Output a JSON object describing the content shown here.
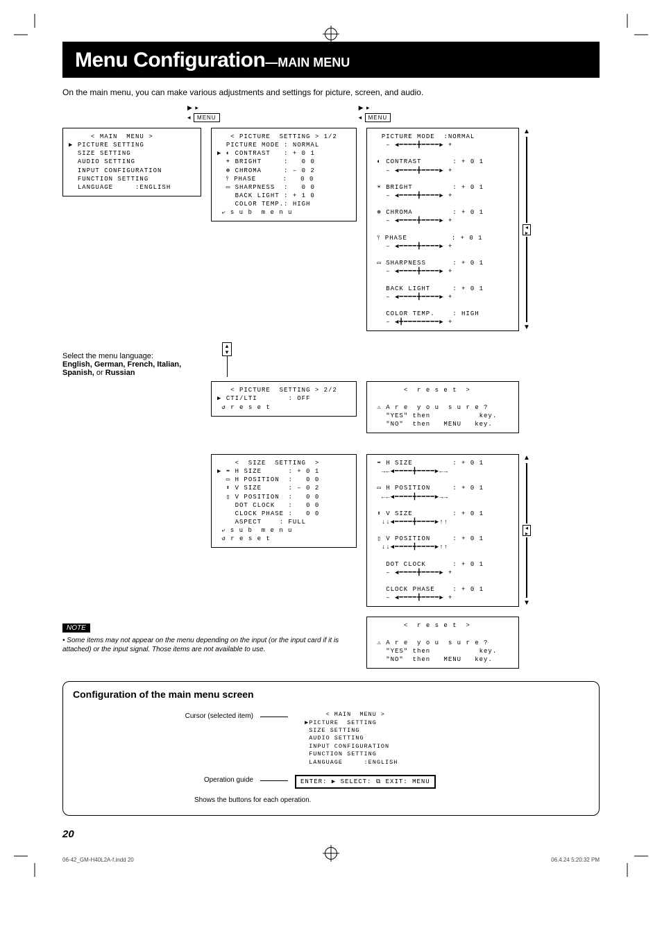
{
  "title": {
    "main": "Menu Configuration",
    "sub": "—MAIN MENU"
  },
  "intro": "On the main menu, you can make various adjustments and settings for picture, screen, and audio.",
  "menu_label": "MENU",
  "main_menu": {
    "heading": "< MAIN  MENU >",
    "items": [
      "PICTURE SETTING",
      "SIZE SETTING",
      "AUDIO SETTING",
      "INPUT CONFIGURATION",
      "FUNCTION SETTING",
      "LANGUAGE     :ENGLISH"
    ],
    "cursor_on": "PICTURE SETTING"
  },
  "lang_note": {
    "lead": "Select the menu language:",
    "langs": "English, German, French, Italian, Spanish,",
    "or": " or ",
    "last": "Russian"
  },
  "picture_p1": {
    "heading": "< PICTURE  SETTING > 1/2",
    "rows": [
      [
        "PICTURE MODE",
        ": NORMAL"
      ],
      [
        "CONTRAST",
        ": + 0 1"
      ],
      [
        "BRIGHT",
        ":   0 0"
      ],
      [
        "CHROMA",
        ": – 0 2"
      ],
      [
        "PHASE",
        ":   0 0"
      ],
      [
        "SHARPNESS",
        ":   0 0"
      ],
      [
        "BACK LIGHT",
        ": + 1 0"
      ],
      [
        "COLOR TEMP.",
        ": HIGH"
      ]
    ],
    "sub": "s u b  m e n u"
  },
  "picture_p2": {
    "heading": "< PICTURE  SETTING > 2/2",
    "rows": [
      [
        "CTI/LTI",
        ": OFF"
      ]
    ],
    "reset": "r e s e t"
  },
  "picture_sliders": {
    "mode_row": [
      "PICTURE MODE",
      ":NORMAL"
    ],
    "rows": [
      [
        "CONTRAST",
        ": + 0 1"
      ],
      [
        "BRIGHT",
        ": + 0 1"
      ],
      [
        "CHROMA",
        ": + 0 1"
      ],
      [
        "PHASE",
        ": + 0 1"
      ],
      [
        "SHARPNESS",
        ": + 0 1"
      ],
      [
        "BACK LIGHT",
        ": + 0 1"
      ],
      [
        "COLOR TEMP.",
        ": HIGH"
      ]
    ]
  },
  "reset_box": {
    "heading": "<  r e s e t  >",
    "q": "A r e  y o u  s u r e ?",
    "yes": "\"YES\" then           key.",
    "no": "\"NO\"  then   MENU   key."
  },
  "size_menu": {
    "heading": "<  SIZE  SETTING  >",
    "rows": [
      [
        "H SIZE",
        ": + 0 1"
      ],
      [
        "H POSITION",
        ":   0 0"
      ],
      [
        "V SIZE",
        ": – 0 2"
      ],
      [
        "V POSITION",
        ":   0 0"
      ],
      [
        "DOT CLOCK",
        ":   0 0"
      ],
      [
        "CLOCK PHASE",
        ":   0 0"
      ],
      [
        "ASPECT",
        ": FULL"
      ]
    ],
    "sub": "s u b  m e n u",
    "reset": "r e s e t"
  },
  "size_sliders": {
    "rows": [
      [
        "H SIZE",
        ": + 0 1"
      ],
      [
        "H POSITION",
        ": + 0 1"
      ],
      [
        "V SIZE",
        ": + 0 1"
      ],
      [
        "V POSITION",
        ": + 0 1"
      ],
      [
        "DOT CLOCK",
        ": + 0 1"
      ],
      [
        "CLOCK PHASE",
        ": + 0 1"
      ]
    ]
  },
  "note": {
    "label": "NOTE",
    "text": "• Some items may not appear on the menu depending on the input (or the input card if it is attached) or the input signal. Those items are not available to use."
  },
  "conf": {
    "title": "Configuration of the main menu screen",
    "cursor_label": "Cursor (selected item)",
    "op_label": "Operation guide",
    "op_sub": "Shows the buttons for each operation.",
    "op_guide": "ENTER: ▶  SELECT: ⧉  EXIT: MENU",
    "mini_menu": {
      "heading": "< MAIN  MENU >",
      "items": [
        "PICTURE  SETTING",
        "SIZE SETTING",
        "AUDIO SETTING",
        "INPUT CONFIGURATION",
        "FUNCTION SETTING",
        "LANGUAGE     :ENGLISH"
      ]
    }
  },
  "page_num": "20",
  "footer": {
    "left": "06-42_GM-H40L2A-f.indd   20",
    "right": "06.4.24   5:20:32 PM"
  }
}
